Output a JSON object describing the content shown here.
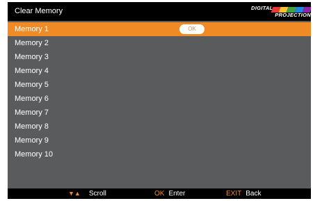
{
  "menu": {
    "title": "Clear Memory",
    "items": [
      {
        "label": "Memory 1",
        "action_label": "OK"
      },
      {
        "label": "Memory 2"
      },
      {
        "label": "Memory 3"
      },
      {
        "label": "Memory 4"
      },
      {
        "label": "Memory 5"
      },
      {
        "label": "Memory 6"
      },
      {
        "label": "Memory 7"
      },
      {
        "label": "Memory 8"
      },
      {
        "label": "Memory 9"
      },
      {
        "label": "Memory 10"
      }
    ],
    "selected_index": 0
  },
  "logo": {
    "line1": "DIGITAL",
    "line2": "PROJECTION",
    "stripe_colors": [
      "#e53935",
      "#fbc02d",
      "#43a047",
      "#1e88e5",
      "#8e24aa"
    ]
  },
  "footer": {
    "scroll_keys": "▼▲",
    "scroll_label": "Scroll",
    "enter_key": "OK",
    "enter_label": "Enter",
    "back_key": "EXIT",
    "back_label": "Back"
  },
  "colors": {
    "accent": "#f08a24",
    "panel_bg": "#5a5b5d",
    "bar_bg": "#000000"
  }
}
